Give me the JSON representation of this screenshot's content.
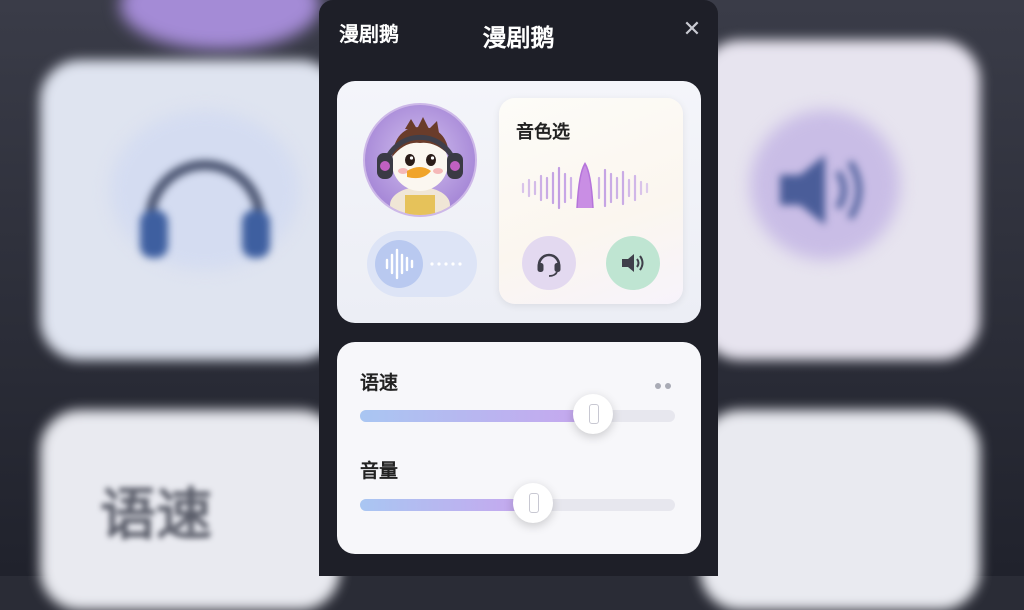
{
  "app": {
    "brand": "漫剧鹅",
    "title": "漫剧鹅",
    "close_icon": "close-icon"
  },
  "voice": {
    "section_title": "音色选",
    "buttons": [
      {
        "icon": "headphones-icon",
        "color": "#e3d9f0"
      },
      {
        "icon": "speaker-icon",
        "color": "#bfe5d2"
      }
    ]
  },
  "sliders": {
    "speed": {
      "label": "语速",
      "value": 0.74
    },
    "volume": {
      "label": "音量",
      "value": 0.55
    }
  },
  "background": {
    "text": "语速"
  },
  "colors": {
    "panel": "#1e1f28",
    "accent": "#c7a6ee",
    "fill_start": "#a9c6f2"
  }
}
